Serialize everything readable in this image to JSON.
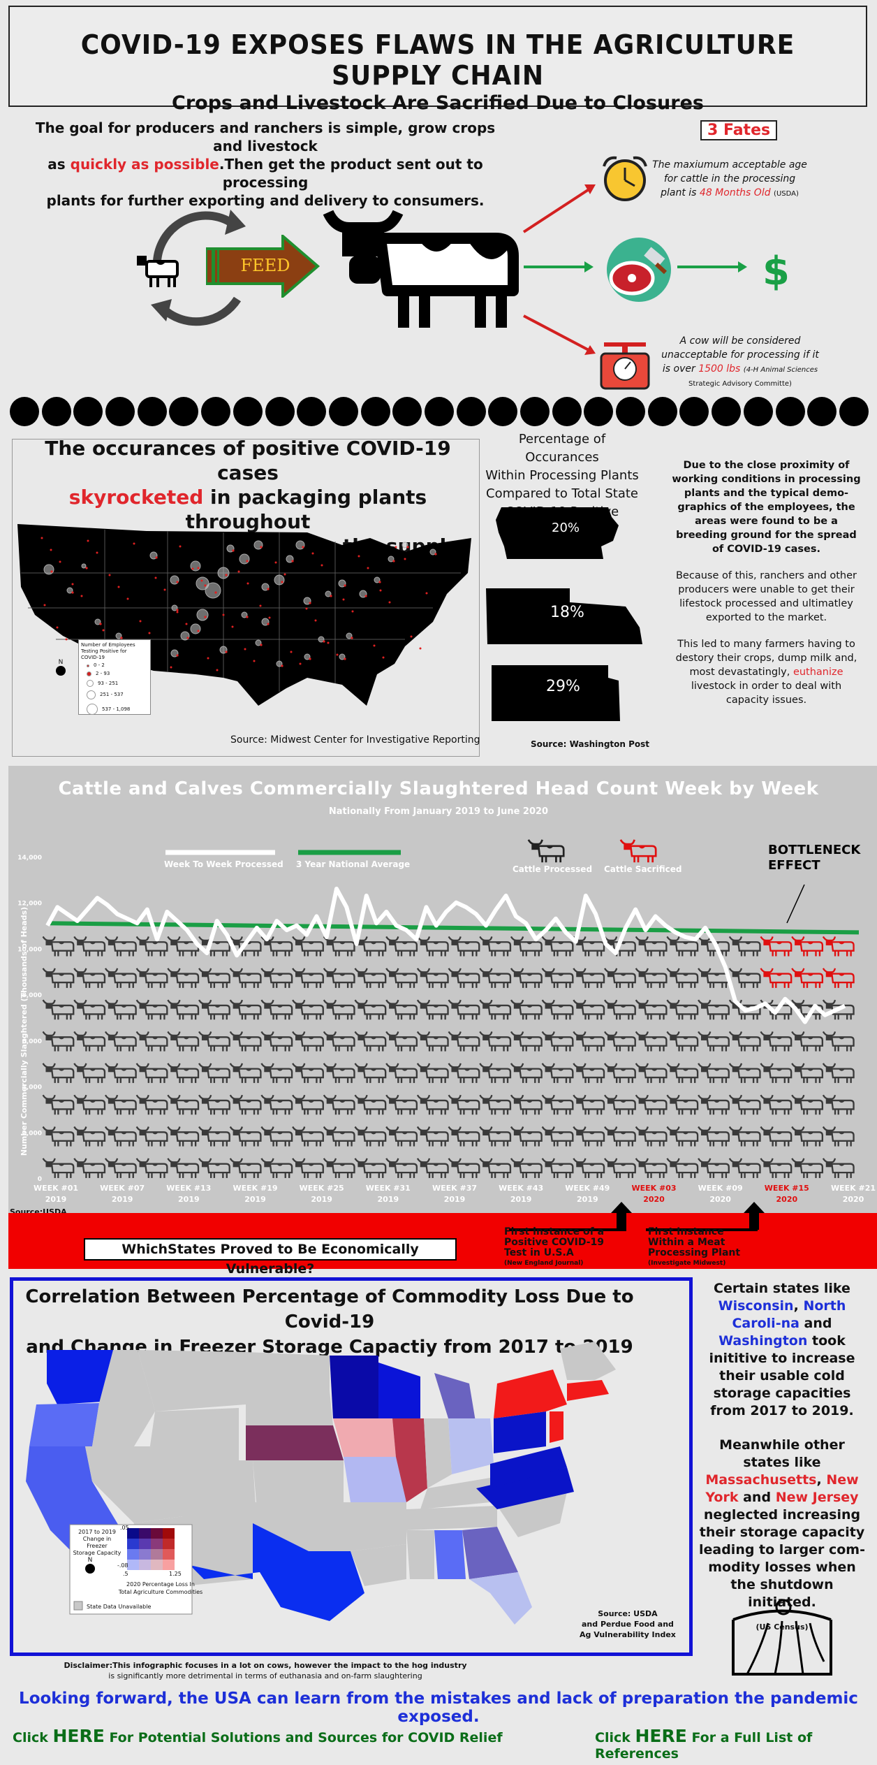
{
  "header": {
    "title": "COVID-19 EXPOSES FLAWS IN THE AGRICULTURE SUPPLY CHAIN",
    "subtitle": "Crops and Livestock Are Sacrified Due to Closures"
  },
  "intro": {
    "line1": "The goal for producers and ranchers is simple, grow crops and livestock",
    "line2a": "as ",
    "line2_red": "quickly as possible",
    "line2b": ".Then get the product sent out to processing",
    "line3": "plants for further exporting and delivery to consumers.",
    "feed_label": "FEED"
  },
  "fates": {
    "title": "3 Fates",
    "f1_a": "The maxiumum acceptable age",
    "f1_b": "for cattle in the processing",
    "f1_c": "plant is ",
    "f1_red": "48 Months Old",
    "f1_src": "(USDA)",
    "dollar": "$",
    "f3_a": "A cow will be considered",
    "f3_b": "unacceptable for processing if it",
    "f3_c": "is over ",
    "f3_red": "1500 lbs",
    "f3_src1": "(4-H Animal Sciences",
    "f3_src2": "Strategic Advisory Committe)"
  },
  "cases": {
    "title_a": "The occurances of positive COVID-19 cases",
    "title_red": "skyrocketed",
    "title_b": " in packaging plants throughout",
    "title_c": "the USA, causing a hault in the supply chain.",
    "legend_title1": "Number of Employees",
    "legend_title2": "Testing Positive for",
    "legend_title3": "COVID-19",
    "legend": [
      "0 - 2",
      "2 - 93",
      "93 - 251",
      "251 - 537",
      "537 - 1,098"
    ],
    "north": "N",
    "source": "Source: Midwest Center for Investigative Reporting"
  },
  "percent": {
    "title": [
      "Percentage of Occurances",
      "Within Processing Plants",
      "Compared to Total State",
      "COVID-19 Positive Instances"
    ],
    "states": [
      "20%",
      "18%",
      "29%"
    ],
    "source": "Source: Washington Post"
  },
  "proximity": {
    "p1": "Due to the close proximity of working conditions in processing plants and the typical demo-graphics of the employees, the areas were found to be a breeding ground for the spread of COVID-19 cases.",
    "p2": "Because of this, ranchers and other producers were unable to get their lifestock processed and ultimatley exported to the market.",
    "p3a": "This led to many farmers having to destory their crops, dump milk and, most devastatingly, ",
    "p3_red": "euthanize",
    "p3b": " livestock in order to deal with capacity issues."
  },
  "chart_data": {
    "type": "line",
    "title": "Cattle and Calves Commercially Slaughtered Head Count Week by Week",
    "subtitle": "Nationally From January 2019 to June 2020",
    "ylabel": "Number Commercially Slaughtered (Thousands of Heads)",
    "ylim": [
      0,
      14000
    ],
    "yticks": [
      "0",
      "2,000",
      "4,000",
      "6,000",
      "8,000",
      "10,000",
      "12,000",
      "14,000"
    ],
    "xticks": [
      {
        "w": "WEEK #01",
        "y": "2019",
        "red": false
      },
      {
        "w": "WEEK #07",
        "y": "2019",
        "red": false
      },
      {
        "w": "WEEK #13",
        "y": "2019",
        "red": false
      },
      {
        "w": "WEEK #19",
        "y": "2019",
        "red": false
      },
      {
        "w": "WEEK #25",
        "y": "2019",
        "red": false
      },
      {
        "w": "WEEK #31",
        "y": "2019",
        "red": false
      },
      {
        "w": "WEEK #37",
        "y": "2019",
        "red": false
      },
      {
        "w": "WEEK #43",
        "y": "2019",
        "red": false
      },
      {
        "w": "WEEK #49",
        "y": "2019",
        "red": false
      },
      {
        "w": "WEEK #03",
        "y": "2020",
        "red": true
      },
      {
        "w": "WEEK #09",
        "y": "2020",
        "red": false
      },
      {
        "w": "WEEK #15",
        "y": "2020",
        "red": true
      },
      {
        "w": "WEEK #21",
        "y": "2020",
        "red": false
      }
    ],
    "series": [
      {
        "name": "Week To Week Processed",
        "color": "#ffffff",
        "values": [
          11000,
          11800,
          11500,
          11200,
          11700,
          12200,
          11900,
          11500,
          11300,
          11100,
          11700,
          10400,
          11600,
          11200,
          10800,
          10200,
          9800,
          11200,
          10600,
          9700,
          10300,
          10900,
          10400,
          11200,
          10800,
          11000,
          10600,
          11400,
          10500,
          12600,
          11800,
          10200,
          12300,
          11100,
          11600,
          11000,
          10800,
          10400,
          11800,
          11000,
          11600,
          12000,
          11800,
          11500,
          11000,
          11700,
          12300,
          11400,
          11100,
          10400,
          10800,
          11300,
          10700,
          10300,
          12300,
          11500,
          10200,
          9800,
          10900,
          11700,
          10800,
          11400,
          11000,
          10700,
          10500,
          10400,
          10900,
          10200,
          9200,
          7700,
          7300,
          7400,
          7600,
          7200,
          7800,
          7400,
          6800,
          7500,
          7100,
          7300,
          7500
        ]
      },
      {
        "name": "3 Year National Average",
        "color": "#1a9e45",
        "values": [
          11100,
          10700
        ]
      }
    ],
    "pictogram_legend": [
      "Cattle Processed",
      "Cattle Sacrificed"
    ],
    "annotation": "BOTTLENECK EFFECT",
    "source": "Source:USDA"
  },
  "events": {
    "e1a": "First instance of a",
    "e1b": "Positive COVID-19",
    "e1c": "Test in U.S.A",
    "e1src": "(New England Journal)",
    "e2a": "First Instance",
    "e2b": "Within a Meat",
    "e2c": "Processing Plant",
    "e2src": "(Investigate Midwest)"
  },
  "vulnerable": {
    "button": "WhichStates Proved to Be  Economically Vulnerable?"
  },
  "storage": {
    "title1": "Correlation Between Percentage of Commodity Loss Due to Covid-19",
    "title2": "and Change in Freezer Storage Capactiy from 2017 to 2019",
    "legend_y1": "2017 to 2019",
    "legend_y2": "Change in Freezer",
    "legend_y3": "Storage Capacity",
    "legend_top": ".05",
    "legend_bot": "-.08",
    "legend_x0": ".5",
    "legend_x1": "1.25",
    "legend_x1l": "2020 Percentage Loss In",
    "legend_x2l": "Total Agriculture Commodities",
    "legend_na": "State Data Unavailable",
    "north": "N",
    "source1": "Source: USDA",
    "source2": "and Perdue Food and",
    "source3": "Ag Vulnerability Index"
  },
  "states": {
    "p1a": "Certain states like ",
    "wi": "Wisconsin",
    "p1b": ", ",
    "nc": "North Caroli-na",
    "p1c": " and ",
    "wa": "Washington",
    "p1d": " took inititive to increase their usable cold storage capacities from 2017 to 2019.",
    "p2a": "Meanwhile other states like ",
    "ma": "Massachusetts",
    "p2b": ", ",
    "ny": "New York",
    "p2c": " and ",
    "nj": "New Jersey",
    "p2d": " neglected increasing their storage capacity leading to larger com-modity losses when the shutdown initiated.",
    "src": "(US Census)"
  },
  "footer": {
    "disc1": "Disclaimer:This infographic focuses in a lot on cows, however the impact to the hog industry",
    "disc2": "is significantly more detrimental in terms of euthanasia and on-farm slaughtering",
    "forward": "Looking forward, the USA can learn from the mistakes and lack of preparation the pandemic exposed.",
    "link1a": "Click ",
    "link1b": "HERE",
    "link1c": " For Potential Solutions and Sources for COVID Relief",
    "link2a": "Click ",
    "link2b": "HERE",
    "link2c": " For a Full List of References"
  }
}
